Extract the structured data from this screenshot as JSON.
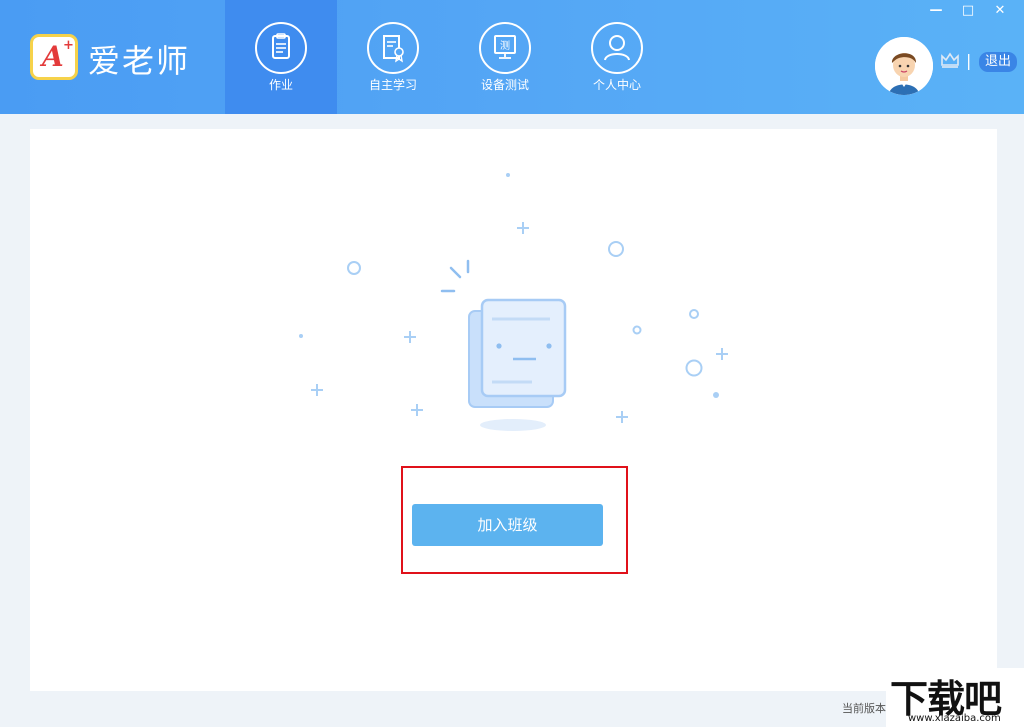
{
  "app": {
    "name": "爱老师",
    "logo_letter": "A",
    "logo_plus": "+"
  },
  "nav": {
    "items": [
      {
        "label": "作业",
        "icon": "clipboard-icon",
        "active": true
      },
      {
        "label": "自主学习",
        "icon": "certificate-icon",
        "active": false
      },
      {
        "label": "设备测试",
        "icon": "monitor-icon",
        "active": false,
        "icon_text": "测"
      },
      {
        "label": "个人中心",
        "icon": "user-icon",
        "active": false
      }
    ]
  },
  "window_controls": {
    "minimize": "—",
    "maximize": "□",
    "close": "✕"
  },
  "user": {
    "separator": "|",
    "logout_label": "退出",
    "avatar_icon": "avatar-icon",
    "vip_icon": "crown-icon"
  },
  "main": {
    "join_class_label": "加入班级"
  },
  "footer": {
    "version_label": "当前版本"
  },
  "watermark": {
    "main": "下载吧",
    "sub": "www.xiazaiba.com"
  },
  "colors": {
    "topbar": "#54a6f5",
    "active_tab": "#3f8cef",
    "button": "#5cb3ef",
    "highlight": "#e0111a"
  }
}
